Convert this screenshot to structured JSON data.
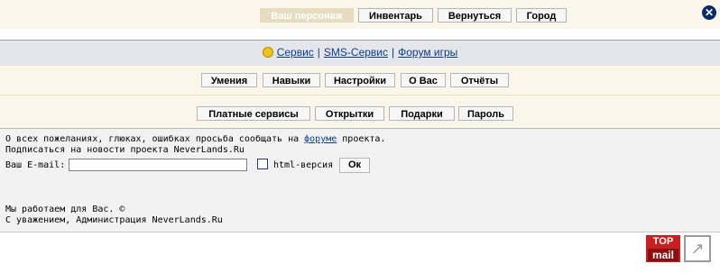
{
  "topnav": {
    "active_label": "Ваш персонаж",
    "inventory_label": "Инвентарь",
    "back_label": "Вернуться",
    "city_label": "Город"
  },
  "services": {
    "service_label": "Сервис",
    "sms_label": "SMS-Сервис",
    "forum_label": "Форум игры",
    "separator": "|"
  },
  "menu_row1": {
    "skills_label": "Умения",
    "abilities_label": "Навыки",
    "settings_label": "Настройки",
    "about_label": "О Вас",
    "reports_label": "Отчёты"
  },
  "menu_row2": {
    "paid_label": "Платные сервисы",
    "postcards_label": "Открытки",
    "gifts_label": "Подарки",
    "password_label": "Пароль"
  },
  "info": {
    "feedback_before": "О всех пожеланиях, глюках, ошибках просьба сообщать на ",
    "feedback_link": "форуме",
    "feedback_after": " проекта.",
    "subscribe_text": "Подписаться на новости проекта NeverLands.Ru",
    "email_label": "Ваш E-mail:",
    "email_value": "",
    "html_version_label": "html-версия",
    "ok_label": "Ок",
    "working_text": "Мы работаем для Вас. ©",
    "regards_text": "С уважением, Администрация NeverLands.Ru"
  },
  "footer": {
    "topmail_top": "TOP",
    "topmail_bottom": "mail",
    "arrow_glyph": "↗"
  },
  "close_glyph": "✕",
  "colors": {
    "band_bg": "#faf7ea",
    "link": "#0b3c8c",
    "service_bg": "#e4e6ea"
  }
}
